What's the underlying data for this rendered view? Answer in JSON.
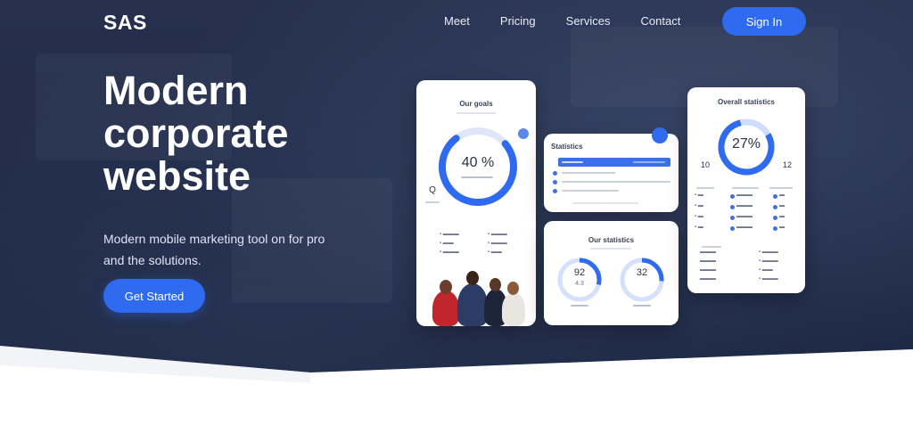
{
  "brand": {
    "logo": "SAS"
  },
  "nav": {
    "items": [
      "Meet",
      "Pricing",
      "Services",
      "Contact"
    ],
    "signin": "Sign In"
  },
  "hero": {
    "headline": "Modern corporate website",
    "subcopy": "Modern mobile marketing tool on for pro and the solutions.",
    "cta": "Get Started"
  },
  "cards": {
    "left": {
      "title": "Our goals",
      "percent": "40 %",
      "left_badge": "Q"
    },
    "middle_top": {
      "title": "Statistics"
    },
    "middle_bottom": {
      "title": "Our statistics",
      "stat_a": "92",
      "stat_a_sub": "4.3",
      "stat_b": "32"
    },
    "right": {
      "title": "Overall statistics",
      "percent": "27%",
      "left_label": "10",
      "right_label": "12"
    }
  },
  "colors": {
    "accent": "#2f6bf0",
    "background": "#1f2a47"
  }
}
